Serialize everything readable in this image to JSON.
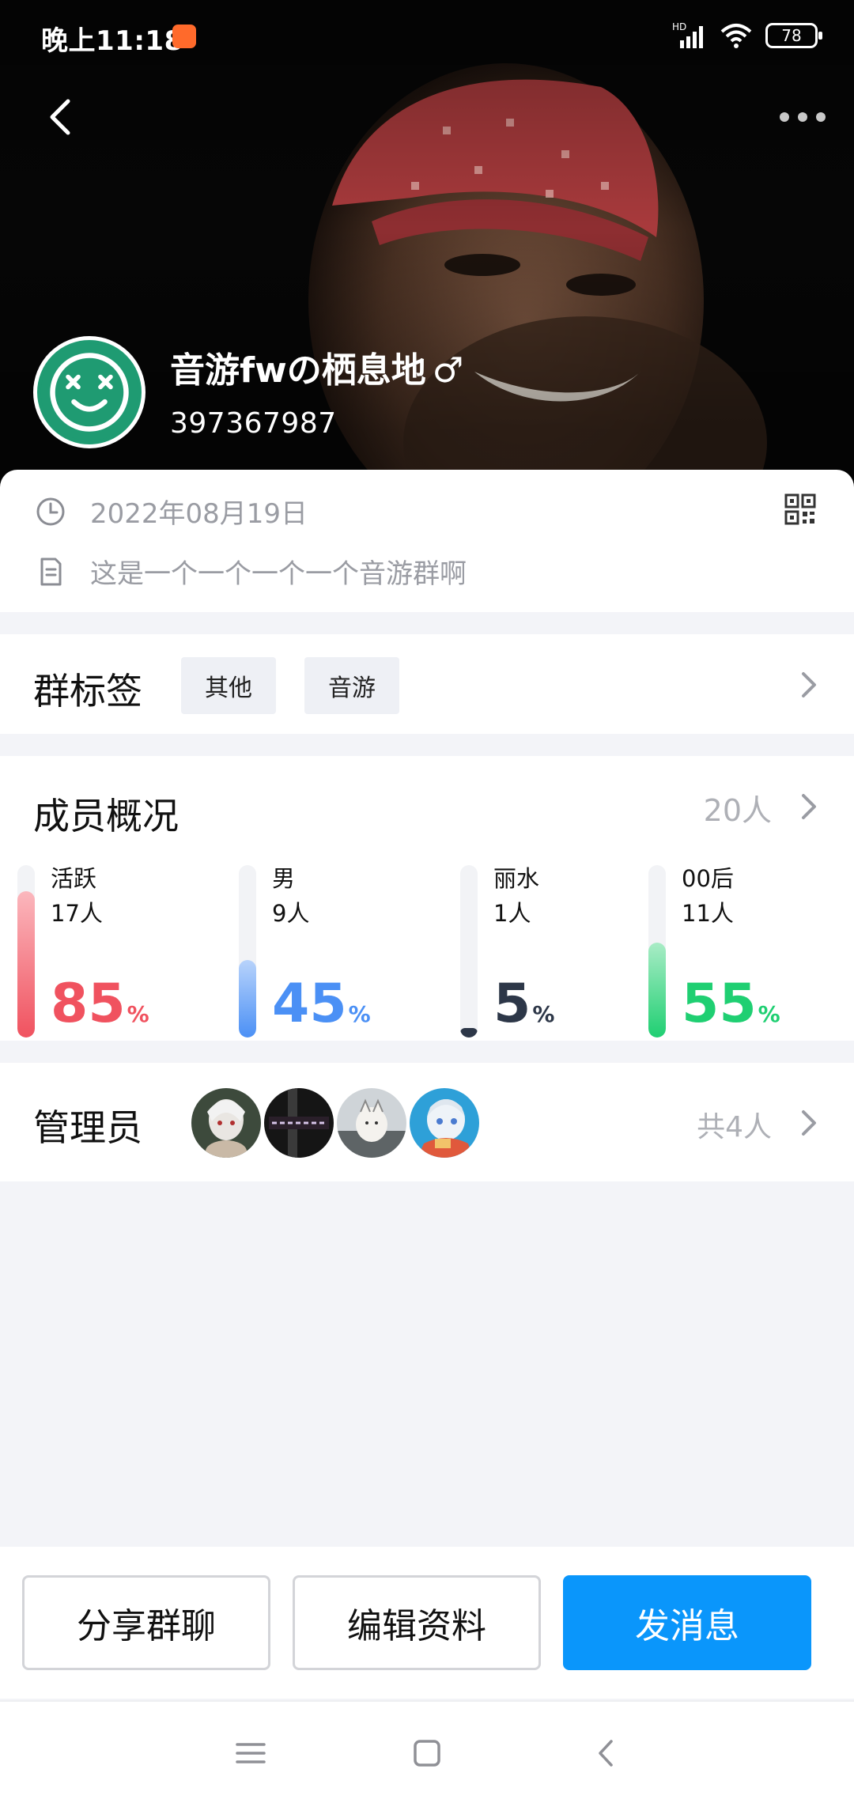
{
  "status_bar": {
    "time": "晚上11:18",
    "network_label": "HD",
    "battery": "78"
  },
  "header": {
    "group_name": "音游fwの栖息地",
    "gender_symbol": "♂",
    "group_id": "397367987"
  },
  "info": {
    "created_date": "2022年08月19日",
    "description": "这是一个一个一个一个音游群啊"
  },
  "tags": {
    "title": "群标签",
    "items": [
      "其他",
      "音游"
    ]
  },
  "members": {
    "title": "成员概况",
    "total": "20人",
    "stats": [
      {
        "label": "活跃",
        "count": "17人",
        "percent": "85",
        "unit": "%",
        "fraction": 0.85,
        "color": "#f0525f"
      },
      {
        "label": "男",
        "count": "9人",
        "percent": "45",
        "unit": "%",
        "fraction": 0.45,
        "color": "#4b90f5"
      },
      {
        "label": "丽水",
        "count": "1人",
        "percent": "5",
        "unit": "%",
        "fraction": 0.05,
        "color": "#2d3748"
      },
      {
        "label": "00后",
        "count": "11人",
        "percent": "55",
        "unit": "%",
        "fraction": 0.55,
        "color": "#1fcf72"
      }
    ]
  },
  "admins": {
    "title": "管理员",
    "total": "共4人",
    "avatar_count": 4
  },
  "actions": {
    "share": "分享群聊",
    "edit": "编辑资料",
    "send": "发消息"
  },
  "colors": {
    "primary": "#0a96fb",
    "avatar_green": "#1f9b72",
    "muted_text": "#9a9ca3"
  }
}
